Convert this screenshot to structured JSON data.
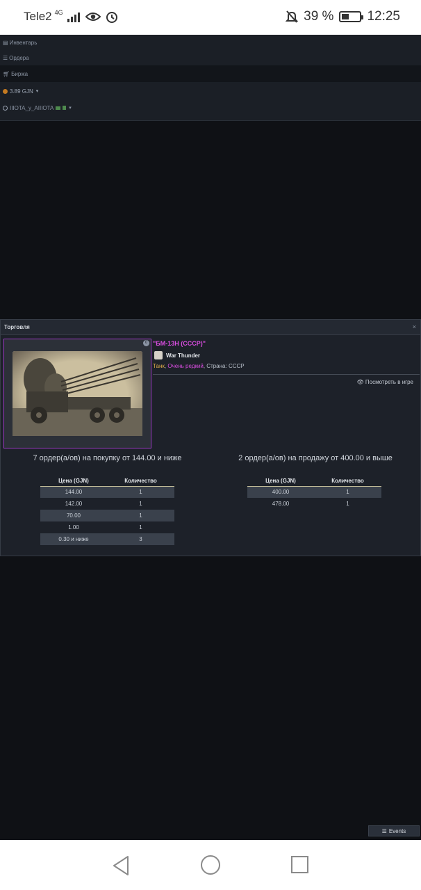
{
  "status_bar": {
    "carrier": "Tele2",
    "network": "4G",
    "battery_percent_label": "39 %",
    "battery_level": 0.39,
    "time": "12:25",
    "icons": [
      "signal-icon",
      "eye-icon",
      "alarm-icon",
      "notifications-off-icon",
      "battery-icon"
    ]
  },
  "menu": {
    "inventory": "Инвентарь",
    "orders": "Ордера",
    "exchange": "Биржа",
    "balance": "3.89 GJN",
    "username": "IIIOTA_y_AIIIOTA"
  },
  "trade": {
    "panel_title": "Торговля",
    "close": "×",
    "item_badge": "0",
    "item_title": "\"БМ-13Н (СССР)\"",
    "game_name": "War Thunder",
    "tag_type": "Танк",
    "tag_sep": ", ",
    "tag_rarity": "Очень редкий",
    "tag_country": ", Страна: СССР",
    "view_in_game": "Посмотреть в игре",
    "buy_heading": "7 ордер(а/ов) на покупку от 144.00 и ниже",
    "sell_heading": "2 ордер(а/ов) на продажу от 400.00 и выше",
    "col_price": "Цена (GJN)",
    "col_qty": "Количество",
    "buy_orders": [
      {
        "price": "144.00",
        "qty": "1"
      },
      {
        "price": "142.00",
        "qty": "1"
      },
      {
        "price": "70.00",
        "qty": "1"
      },
      {
        "price": "1.00",
        "qty": "1"
      },
      {
        "price": "0.30 и ниже",
        "qty": "3"
      }
    ],
    "sell_orders": [
      {
        "price": "400.00",
        "qty": "1"
      },
      {
        "price": "478.00",
        "qty": "1"
      }
    ]
  },
  "events_button": "Events",
  "colors": {
    "accent_purple": "#d94de0",
    "tank_orange": "#e1ad4a",
    "background": "#0f1115"
  }
}
